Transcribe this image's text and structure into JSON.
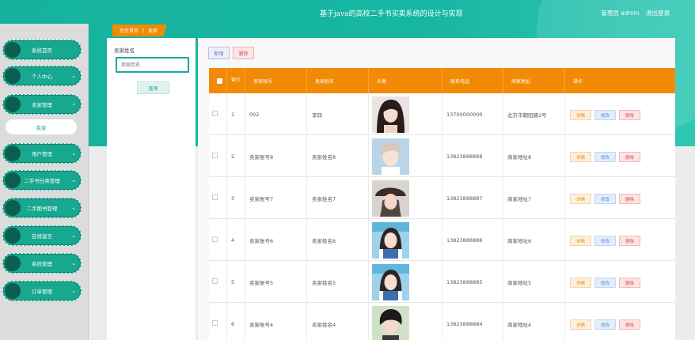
{
  "header": {
    "title": "基于java的高校二手书买卖系统的设计与实现",
    "user_label": "管理员 admin",
    "logout_label": "退出登录"
  },
  "sidebar": {
    "items": [
      {
        "label": "系统首页",
        "has_chevron": false
      },
      {
        "label": "个人中心",
        "has_chevron": true,
        "chevron": "⌄"
      },
      {
        "label": "卖家管理",
        "has_chevron": true,
        "chevron": "⌃",
        "expanded": true
      },
      {
        "label": "用户管理",
        "has_chevron": true,
        "chevron": "⌄"
      },
      {
        "label": "二手书分类管理",
        "has_chevron": true,
        "chevron": "⌄"
      },
      {
        "label": "二手图书管理",
        "has_chevron": true,
        "chevron": "⌄"
      },
      {
        "label": "在线留言",
        "has_chevron": true,
        "chevron": "⌄"
      },
      {
        "label": "系统管理",
        "has_chevron": true,
        "chevron": "⌄"
      },
      {
        "label": "订单管理",
        "has_chevron": true,
        "chevron": "⌄"
      }
    ],
    "sub_item": "卖家"
  },
  "breadcrumb": {
    "home": "后台首页",
    "separator": "|",
    "current": "卖家"
  },
  "search": {
    "label": "卖家姓名",
    "placeholder": "卖家姓名",
    "button": "查询"
  },
  "toolbar": {
    "add": "新增",
    "delete": "删除"
  },
  "table": {
    "headers": {
      "index": "索引",
      "account": "卖家账号",
      "name": "卖家姓名",
      "avatar": "头像",
      "phone": "联系电话",
      "address": "商家地址",
      "ops": "操作"
    },
    "rows": [
      {
        "index": "1",
        "account": "002",
        "name": "李四",
        "phone": "13700000000",
        "address": "北京市朝阳路2号",
        "avatar": "girl-dark-hair"
      },
      {
        "index": "2",
        "account": "卖家账号8",
        "name": "卖家姓名8",
        "phone": "13823888888",
        "address": "商家地址8",
        "avatar": "boy-light-hair"
      },
      {
        "index": "3",
        "account": "卖家账号7",
        "name": "卖家姓名7",
        "phone": "13823888887",
        "address": "商家地址7",
        "avatar": "girl-hat"
      },
      {
        "index": "4",
        "account": "卖家账号6",
        "name": "卖家姓名6",
        "phone": "13823888886",
        "address": "商家地址6",
        "avatar": "girl-blue"
      },
      {
        "index": "5",
        "account": "卖家账号5",
        "name": "卖家姓名5",
        "phone": "13823888885",
        "address": "商家地址5",
        "avatar": "girl-blue"
      },
      {
        "index": "6",
        "account": "卖家账号4",
        "name": "卖家姓名4",
        "phone": "13823888884",
        "address": "商家地址4",
        "avatar": "boy-dark-hair"
      }
    ],
    "ops": {
      "detail": "详情",
      "edit": "修改",
      "delete": "删除"
    }
  },
  "colors": {
    "accent": "#17a88f",
    "header_bg": "#f28a03",
    "danger": "#d9534f"
  }
}
